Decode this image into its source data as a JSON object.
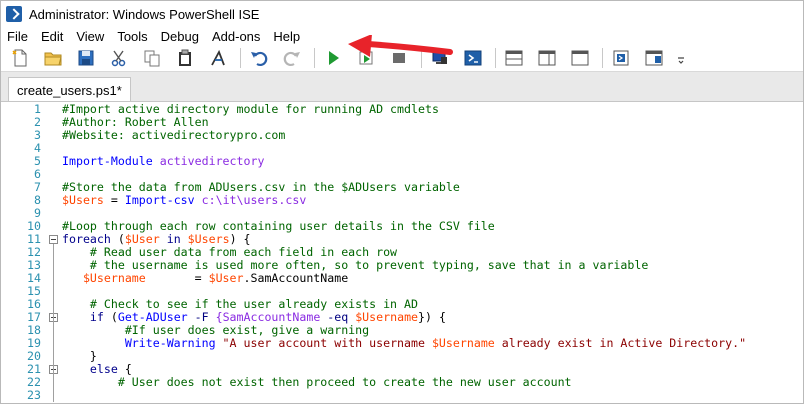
{
  "window": {
    "title": "Administrator: Windows PowerShell ISE"
  },
  "menu": [
    "File",
    "Edit",
    "View",
    "Tools",
    "Debug",
    "Add-ons",
    "Help"
  ],
  "toolbar": {
    "buttons": [
      "new-icon",
      "open-icon",
      "save-icon",
      "cut-icon",
      "copy-icon",
      "paste-icon",
      "clear-console-icon",
      "undo-icon",
      "redo-icon",
      "run-script-icon",
      "run-selection-icon",
      "stop-icon",
      "remote-powershell-icon",
      "start-powershell-icon",
      "show-script-pane-top-icon",
      "show-script-pane-right-icon",
      "show-script-pane-max-icon",
      "show-command-window-icon",
      "show-command-addon-icon",
      "customize-toolbar-icon"
    ],
    "accent": "#e8232a"
  },
  "tab": {
    "label": "create_users.ps1*"
  },
  "editor": {
    "lines": [
      {
        "n": "1",
        "segs": [
          {
            "t": "#Import active directory module for running AD cmdlets",
            "c": "c-com"
          }
        ]
      },
      {
        "n": "2",
        "segs": [
          {
            "t": "#Author: Robert Allen",
            "c": "c-com"
          }
        ]
      },
      {
        "n": "3",
        "segs": [
          {
            "t": "#Website: activedirectorypro.com",
            "c": "c-com"
          }
        ]
      },
      {
        "n": "4",
        "segs": []
      },
      {
        "n": "5",
        "segs": [
          {
            "t": "Import-Module ",
            "c": "c-cmd"
          },
          {
            "t": "activedirectory",
            "c": "c-arg"
          }
        ]
      },
      {
        "n": "6",
        "segs": []
      },
      {
        "n": "7",
        "segs": [
          {
            "t": "#Store the data from ADUsers.csv in the $ADUsers variable",
            "c": "c-com"
          }
        ]
      },
      {
        "n": "8",
        "segs": [
          {
            "t": "$Users",
            "c": "c-var"
          },
          {
            "t": " = ",
            "c": "c-txt"
          },
          {
            "t": "Import-csv ",
            "c": "c-cmd"
          },
          {
            "t": "c:\\it\\users.csv",
            "c": "c-arg"
          }
        ]
      },
      {
        "n": "9",
        "segs": []
      },
      {
        "n": "10",
        "segs": [
          {
            "t": "#Loop through each row containing user details in the CSV file",
            "c": "c-com"
          }
        ]
      },
      {
        "n": "11",
        "fold": true,
        "segs": [
          {
            "t": "foreach",
            "c": "c-kw"
          },
          {
            "t": " (",
            "c": "c-txt"
          },
          {
            "t": "$User",
            "c": "c-var"
          },
          {
            "t": " in ",
            "c": "c-kw"
          },
          {
            "t": "$Users",
            "c": "c-var"
          },
          {
            "t": ") {",
            "c": "c-txt"
          }
        ]
      },
      {
        "n": "12",
        "segs": [
          {
            "t": "    # Read user data from each field in each row",
            "c": "c-com"
          }
        ]
      },
      {
        "n": "13",
        "segs": [
          {
            "t": "    # the username is used more often, so to prevent typing, save that in a variable",
            "c": "c-com"
          }
        ]
      },
      {
        "n": "14",
        "segs": [
          {
            "t": "   $Username",
            "c": "c-var"
          },
          {
            "t": "       = ",
            "c": "c-txt"
          },
          {
            "t": "$User",
            "c": "c-var"
          },
          {
            "t": ".SamAccountName",
            "c": "c-txt"
          }
        ]
      },
      {
        "n": "15",
        "segs": []
      },
      {
        "n": "16",
        "segs": [
          {
            "t": "    # Check to see if the user already exists in AD",
            "c": "c-com"
          }
        ]
      },
      {
        "n": "17",
        "fold": true,
        "segs": [
          {
            "t": "    if",
            "c": "c-kw"
          },
          {
            "t": " (",
            "c": "c-txt"
          },
          {
            "t": "Get-ADUser",
            "c": "c-cmd"
          },
          {
            "t": " -F ",
            "c": "c-prm"
          },
          {
            "t": "{SamAccountName ",
            "c": "c-arg"
          },
          {
            "t": "-eq ",
            "c": "c-prm"
          },
          {
            "t": "$Username",
            "c": "c-var"
          },
          {
            "t": "}) {",
            "c": "c-txt"
          }
        ]
      },
      {
        "n": "18",
        "segs": [
          {
            "t": "         #If user does exist, give a warning",
            "c": "c-com"
          }
        ]
      },
      {
        "n": "19",
        "segs": [
          {
            "t": "         Write-Warning ",
            "c": "c-cmd"
          },
          {
            "t": "\"A user account with username ",
            "c": "c-str"
          },
          {
            "t": "$Username",
            "c": "c-var"
          },
          {
            "t": " already exist in Active Directory.\"",
            "c": "c-str"
          }
        ]
      },
      {
        "n": "20",
        "segs": [
          {
            "t": "    }",
            "c": "c-txt"
          }
        ]
      },
      {
        "n": "21",
        "fold": true,
        "segs": [
          {
            "t": "    else",
            "c": "c-kw"
          },
          {
            "t": " {",
            "c": "c-txt"
          }
        ]
      },
      {
        "n": "22",
        "segs": [
          {
            "t": "        # User does not exist then proceed to create the new user account",
            "c": "c-com"
          }
        ]
      },
      {
        "n": "23",
        "segs": []
      }
    ]
  },
  "colors": {
    "comment": "#006400",
    "cmdlet": "#0000ff",
    "variable": "#ff4500",
    "keyword": "#00008b",
    "argument": "#8a2be2",
    "string": "#8b0000",
    "line_number": "#2b91af"
  }
}
